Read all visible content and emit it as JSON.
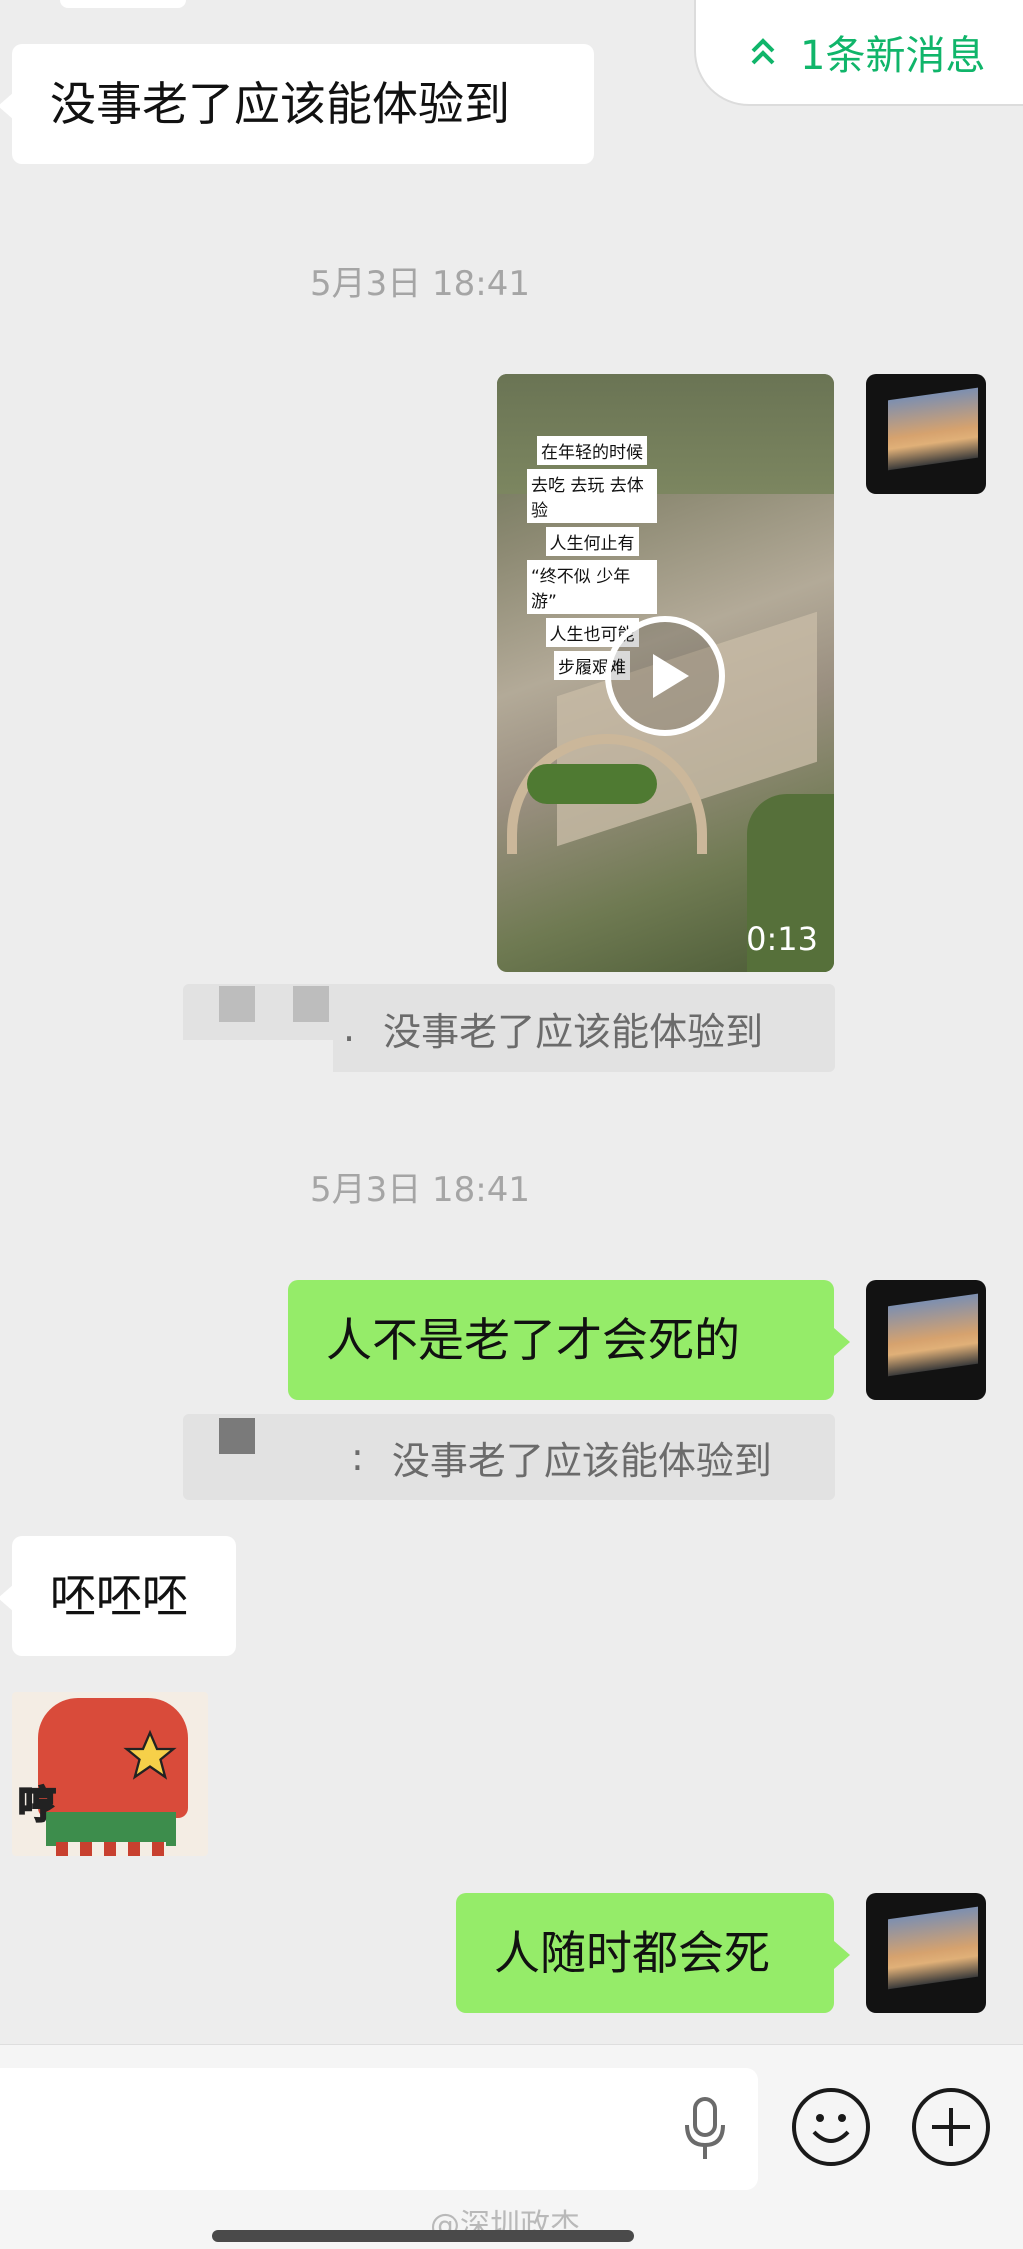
{
  "new_message_pill": {
    "label": "1条新消息",
    "icon": "double-chevron-up-icon",
    "color": "#10b56a"
  },
  "messages": {
    "incoming_1": "没事老了应该能体验到",
    "timestamp_1": "5月3日 18:41",
    "video": {
      "overlay_lines": [
        "在年轻的时候",
        "去吃 去玩 去体验",
        "人生何止有",
        "“终不似 少年游”",
        "人生也可能",
        "步履艰难"
      ],
      "duration": "0:13"
    },
    "quote_1": {
      "sep": ".",
      "text": "没事老了应该能体验到"
    },
    "timestamp_2": "5月3日 18:41",
    "outgoing_1": "人不是老了才会死的",
    "quote_2": {
      "sep": ":",
      "text": "没事老了应该能体验到"
    },
    "incoming_2": "呸呸呸",
    "sticker_text": "哼",
    "outgoing_2": "人随时都会死"
  },
  "input_bar": {
    "voice_icon": "microphone-icon",
    "emoji_icon": "emoji-icon",
    "add_icon": "plus-circle-icon"
  },
  "watermark": "@深圳政杰",
  "colors": {
    "background": "#ededed",
    "outgoing_bubble": "#95ec69",
    "incoming_bubble": "#ffffff"
  }
}
